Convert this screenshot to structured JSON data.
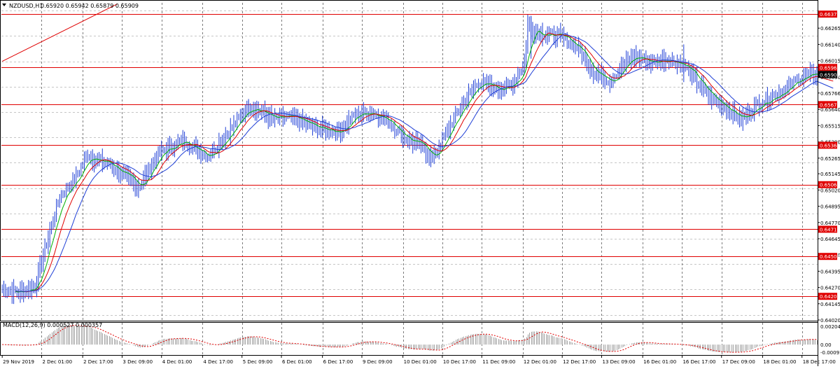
{
  "colors": {
    "background": "#ffffff",
    "grid": "#000000",
    "price_bars": "#1f3fd6",
    "sma_fast": "#00b000",
    "sma_mid": "#e00000",
    "sma_slow": "#1f3fd6",
    "level_line": "#e00000",
    "macd_hist": "#a0a0a0",
    "macd_signal": "#e00000",
    "axis_text": "#000000"
  },
  "header": {
    "symbol_label": "NZDUSD,H1",
    "ohlc_label": "0.65920 0.65942 0.65879 0.65909",
    "collapse_icon": "triangle-down-icon"
  },
  "chart_data": [
    {
      "type": "ohlc",
      "title": "NZDUSD,H1  0.65920 0.65942 0.65879 0.65909",
      "symbol": "NZDUSD",
      "timeframe": "H1",
      "last_ohlc": {
        "open": 0.6592,
        "high": 0.65942,
        "low": 0.65879,
        "close": 0.65909
      },
      "ylim": [
        0.6402,
        0.6646
      ],
      "y_ticks": [
        "0.66265",
        "0.66140",
        "0.66015",
        "0.65890",
        "0.65766",
        "0.65640",
        "0.65515",
        "0.65390",
        "0.65265",
        "0.65145",
        "0.65020",
        "0.64895",
        "0.64770",
        "0.64645",
        "0.64520",
        "0.64395",
        "0.64270",
        "0.64145",
        "0.64020"
      ],
      "x_ticks": [
        "29 Nov 2019",
        "2 Dec 01:00",
        "2 Dec 17:00",
        "3 Dec 09:00",
        "4 Dec 01:00",
        "4 Dec 17:00",
        "5 Dec 09:00",
        "6 Dec 01:00",
        "6 Dec 17:00",
        "9 Dec 09:00",
        "10 Dec 01:00",
        "10 Dec 17:00",
        "11 Dec 09:00",
        "12 Dec 01:00",
        "12 Dec 17:00",
        "13 Dec 09:00",
        "16 Dec 01:00",
        "16 Dec 17:00",
        "17 Dec 09:00",
        "18 Dec 01:00",
        "18 Dec 17:00"
      ],
      "price_path": {
        "series_index": [
          0,
          10,
          20,
          25,
          35,
          45,
          52,
          55,
          65,
          75,
          83,
          95,
          110,
          125,
          140,
          150,
          158,
          165,
          172,
          180,
          190,
          205,
          215,
          225,
          235,
          245,
          255,
          262,
          270,
          280,
          290,
          300,
          310,
          318,
          320,
          322,
          330,
          340,
          350,
          360,
          370,
          378,
          385,
          395,
          405,
          415,
          425,
          432,
          440,
          450,
          460,
          470,
          480,
          485,
          490,
          496
        ],
        "close": [
          0.6426,
          0.6423,
          0.6428,
          0.6452,
          0.6497,
          0.6512,
          0.653,
          0.6526,
          0.6522,
          0.6512,
          0.6504,
          0.653,
          0.654,
          0.6528,
          0.655,
          0.6567,
          0.6562,
          0.6556,
          0.6558,
          0.6556,
          0.655,
          0.6547,
          0.656,
          0.6562,
          0.6555,
          0.6542,
          0.6536,
          0.6526,
          0.6545,
          0.6568,
          0.6585,
          0.658,
          0.6582,
          0.66,
          0.663,
          0.6625,
          0.6622,
          0.662,
          0.6612,
          0.6593,
          0.6586,
          0.6598,
          0.6605,
          0.66,
          0.6603,
          0.6598,
          0.6582,
          0.6572,
          0.6566,
          0.6556,
          0.6568,
          0.6575,
          0.6582,
          0.6588,
          0.659,
          0.6591
        ]
      },
      "level_lines": [
        {
          "value": 0.66373,
          "label": "0.66373"
        },
        {
          "value": 0.65963,
          "label": "0.65963"
        },
        {
          "value": 0.65677,
          "label": "0.65677"
        },
        {
          "value": 0.65364,
          "label": "0.65364"
        },
        {
          "value": 0.65061,
          "label": "0.65061"
        },
        {
          "value": 0.64718,
          "label": "0.64718"
        },
        {
          "value": 0.64509,
          "label": "0.64509"
        },
        {
          "value": 0.64202,
          "label": "0.64202"
        }
      ],
      "current_price": {
        "value": 0.65909,
        "label": "0.65909"
      },
      "trendline": {
        "from": {
          "index": 0,
          "value": 0.6601
        },
        "to": {
          "index": 70,
          "value": 0.6645
        }
      },
      "moving_averages": [
        {
          "period": "fast",
          "color": "#00b000"
        },
        {
          "period": "mid",
          "color": "#e00000"
        },
        {
          "period": "slow",
          "color": "#1f3fd6"
        }
      ],
      "grid": true
    },
    {
      "type": "bar",
      "title": "MACD(12,26,9) 0.000527 0.000357",
      "indicator": "MACD",
      "params": [
        12,
        26,
        9
      ],
      "values_label": [
        "0.000527",
        "0.000357"
      ],
      "ylim": [
        -0.000917,
        0.002047
      ],
      "y_ticks": [
        "0.002047",
        "0.00",
        "-0.000917"
      ],
      "grid": true
    }
  ]
}
